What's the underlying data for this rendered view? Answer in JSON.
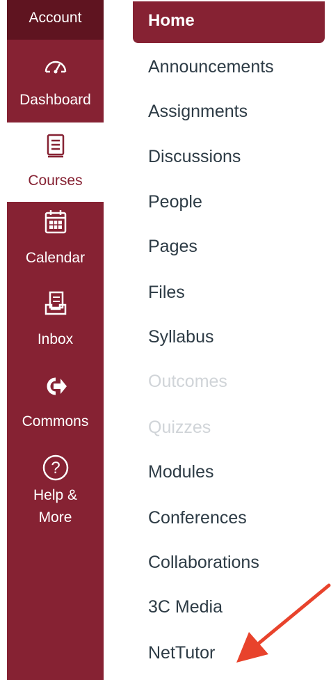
{
  "global_nav": {
    "account_label": "Account",
    "items": [
      {
        "label": "Dashboard",
        "icon": "dashboard-gauge-icon"
      },
      {
        "label": "Courses",
        "icon": "book-icon",
        "active": true
      },
      {
        "label": "Calendar",
        "icon": "calendar-icon"
      },
      {
        "label": "Inbox",
        "icon": "inbox-icon"
      },
      {
        "label": "Commons",
        "icon": "commons-arrow-icon"
      },
      {
        "label": "Help &",
        "label2": "More",
        "icon": "help-question-icon"
      }
    ]
  },
  "course_nav": {
    "home_label": "Home",
    "items": [
      {
        "label": "Announcements"
      },
      {
        "label": "Assignments"
      },
      {
        "label": "Discussions"
      },
      {
        "label": "People"
      },
      {
        "label": "Pages"
      },
      {
        "label": "Files"
      },
      {
        "label": "Syllabus"
      },
      {
        "label": "Outcomes",
        "disabled": true
      },
      {
        "label": "Quizzes",
        "disabled": true
      },
      {
        "label": "Modules"
      },
      {
        "label": "Conferences"
      },
      {
        "label": "Collaborations"
      },
      {
        "label": "3C Media"
      },
      {
        "label": "NetTutor"
      }
    ]
  },
  "colors": {
    "brand": "#862233",
    "brand_dark": "#5f1420",
    "link": "#2d3b45",
    "disabled": "#d0d4d8",
    "annotation_arrow": "#e8432c"
  }
}
